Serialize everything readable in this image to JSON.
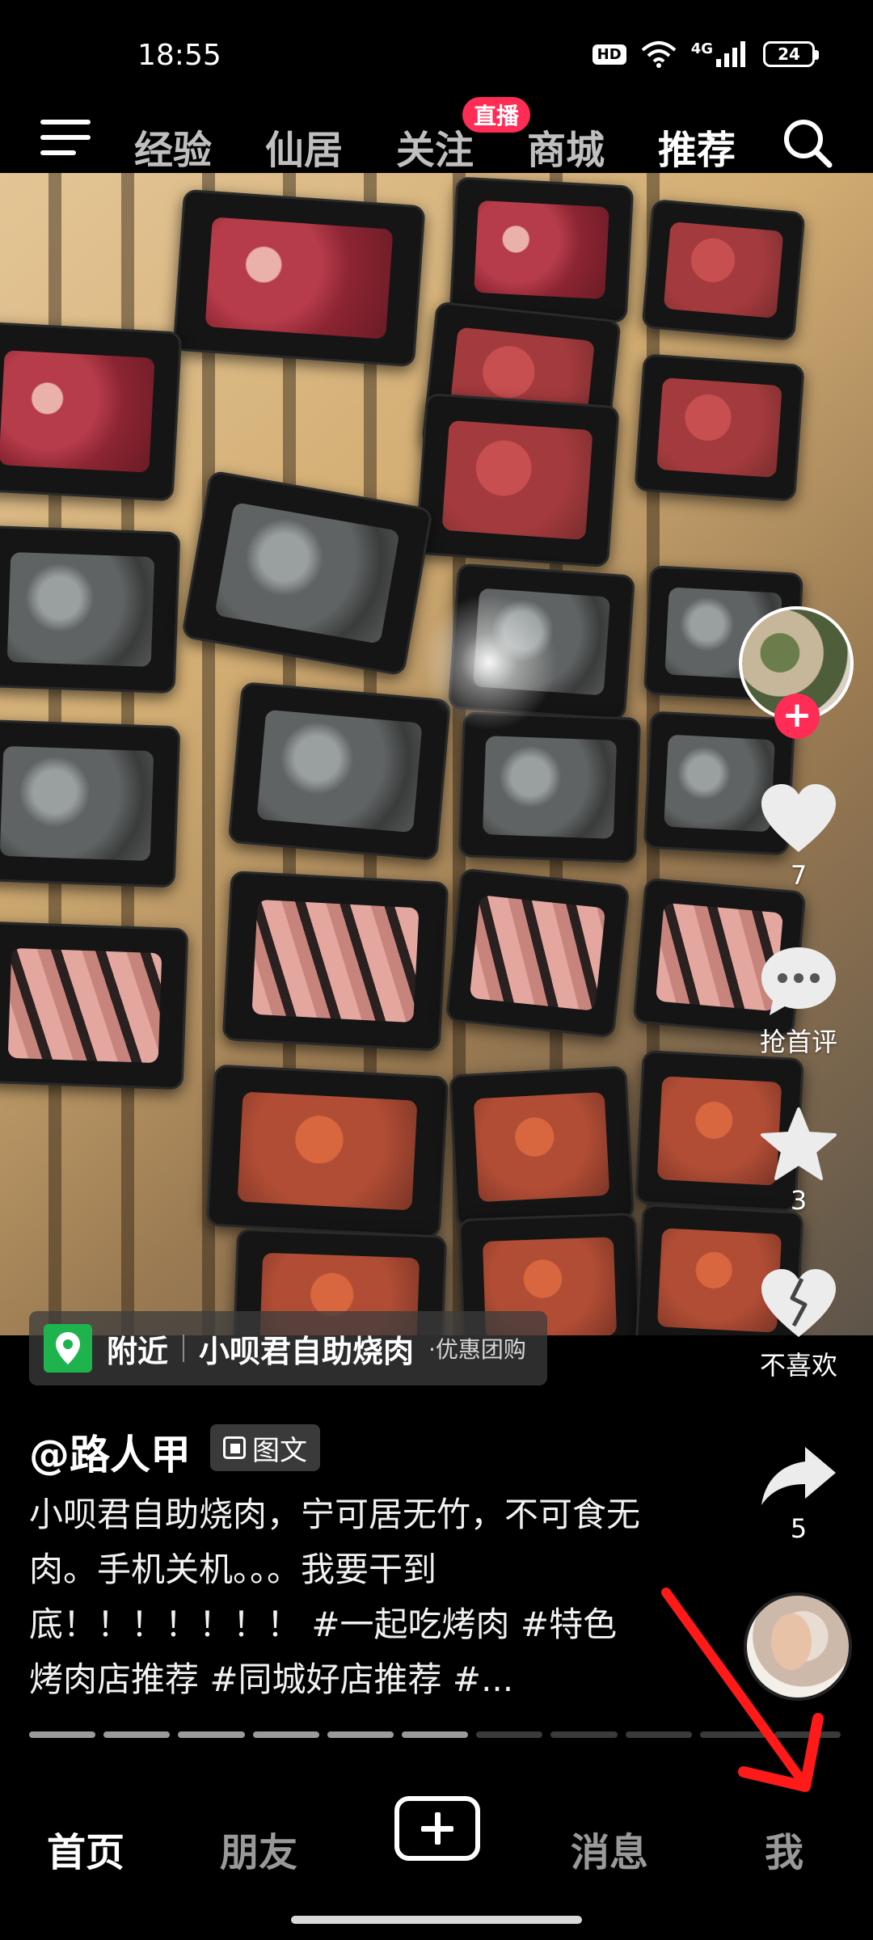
{
  "status_bar": {
    "time": "18:55",
    "hd": "HD",
    "network": "4G",
    "battery": "24"
  },
  "top_nav": {
    "tabs": [
      {
        "label": "经验"
      },
      {
        "label": "仙居"
      },
      {
        "label": "关注"
      },
      {
        "label": "商城"
      },
      {
        "label": "推荐"
      }
    ],
    "active_tab": "推荐",
    "live_badge": "直播"
  },
  "actions": {
    "like_count": "7",
    "comment_label": "抢首评",
    "favorite_count": "3",
    "dislike_label": "不喜欢",
    "share_count": "5"
  },
  "location": {
    "near": "附近",
    "name": "小呗君自助烧肉",
    "promo": "·优惠团购"
  },
  "post": {
    "author": "@路人甲",
    "type_tag": "图文",
    "caption": "小呗君自助烧肉，宁可居无竹，不可食无肉。手机关机。。。我要干到底！！！！！！！ #一起吃烤肉 #特色烤肉店推荐 #同城好店推荐 #..."
  },
  "progress": {
    "total_segments": 11,
    "viewed_segments": 6
  },
  "bottom_nav": {
    "home": "首页",
    "friends": "朋友",
    "messages": "消息",
    "me": "我"
  },
  "colors": {
    "accent": "#ff2c55",
    "location_icon": "#1fb34e",
    "annotation_arrow": "#ff1a1a"
  }
}
